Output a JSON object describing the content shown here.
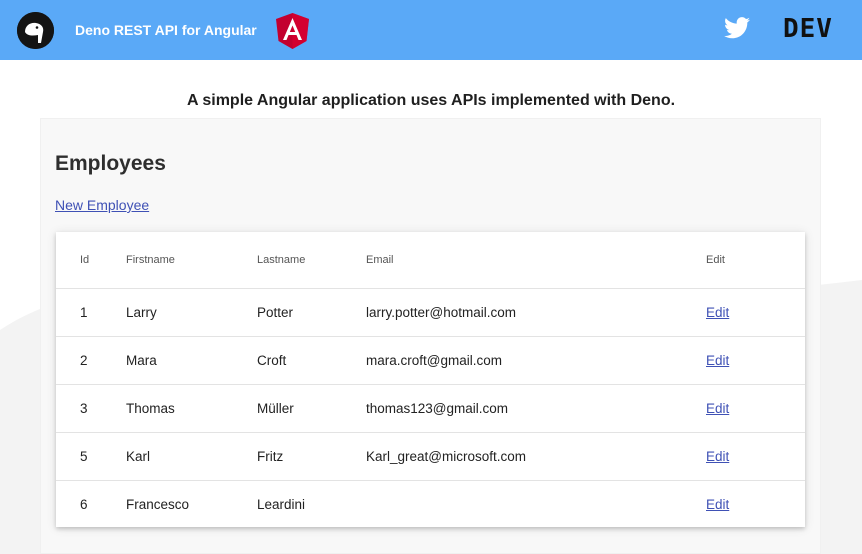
{
  "header": {
    "app_title": "Deno REST API for Angular",
    "angular_logo": "angular-logo",
    "twitter_icon": "twitter-icon",
    "dev_logo_text": "DEV",
    "background_color": "#5aa9f7"
  },
  "main": {
    "subtitle": "A simple Angular application uses APIs implemented with Deno.",
    "panel_title": "Employees",
    "new_employee_link": "New Employee",
    "link_color": "#3f51b5"
  },
  "table": {
    "columns": [
      "Id",
      "Firstname",
      "Lastname",
      "Email",
      "Edit"
    ],
    "rows": [
      {
        "id": "1",
        "firstname": "Larry",
        "lastname": "Potter",
        "email": "larry.potter@hotmail.com",
        "edit": "Edit"
      },
      {
        "id": "2",
        "firstname": "Mara",
        "lastname": "Croft",
        "email": "mara.croft@gmail.com",
        "edit": "Edit"
      },
      {
        "id": "3",
        "firstname": "Thomas",
        "lastname": "Müller",
        "email": "thomas123@gmail.com",
        "edit": "Edit"
      },
      {
        "id": "5",
        "firstname": "Karl",
        "lastname": "Fritz",
        "email": "Karl_great@microsoft.com",
        "edit": "Edit"
      },
      {
        "id": "6",
        "firstname": "Francesco",
        "lastname": "Leardini",
        "email": "",
        "edit": "Edit"
      }
    ]
  }
}
